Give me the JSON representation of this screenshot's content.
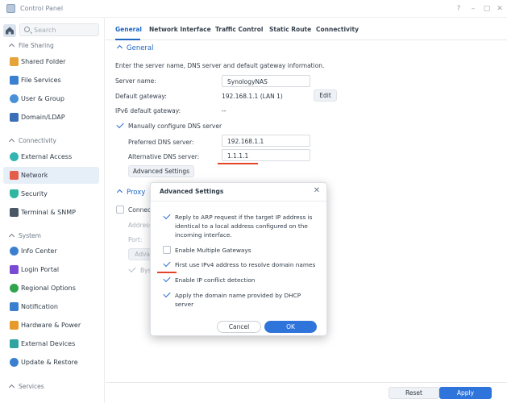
{
  "window": {
    "title": "Control Panel"
  },
  "sidebar": {
    "search_placeholder": "Search",
    "sections": [
      {
        "label": "File Sharing"
      },
      {
        "label": "Connectivity"
      },
      {
        "label": "System"
      },
      {
        "label": "Services"
      }
    ],
    "items": [
      {
        "label": "Shared Folder",
        "icon": "shared-folder-icon",
        "color": "#e6a33a"
      },
      {
        "label": "File Services",
        "icon": "file-services-icon",
        "color": "#3b7fd1"
      },
      {
        "label": "User & Group",
        "icon": "user-group-icon",
        "color": "#4a90d9"
      },
      {
        "label": "Domain/LDAP",
        "icon": "domain-ldap-icon",
        "color": "#3a6fb8"
      },
      {
        "label": "External Access",
        "icon": "external-access-icon",
        "color": "#32b4b0"
      },
      {
        "label": "Network",
        "icon": "network-icon",
        "color": "#e45d4a"
      },
      {
        "label": "Security",
        "icon": "security-icon",
        "color": "#2fb6a0"
      },
      {
        "label": "Terminal & SNMP",
        "icon": "terminal-icon",
        "color": "#4a5866"
      },
      {
        "label": "Info Center",
        "icon": "info-center-icon",
        "color": "#3b7fd1"
      },
      {
        "label": "Login Portal",
        "icon": "login-portal-icon",
        "color": "#7a4ad3"
      },
      {
        "label": "Regional Options",
        "icon": "regional-options-icon",
        "color": "#2fa44a"
      },
      {
        "label": "Notification",
        "icon": "notification-icon",
        "color": "#3b7fd1"
      },
      {
        "label": "Hardware & Power",
        "icon": "hardware-power-icon",
        "color": "#e69a2a"
      },
      {
        "label": "External Devices",
        "icon": "external-devices-icon",
        "color": "#2fa4a0"
      },
      {
        "label": "Update & Restore",
        "icon": "update-restore-icon",
        "color": "#3b7fd1"
      }
    ],
    "active_item": "Network"
  },
  "tabs": [
    {
      "label": "General",
      "active": true
    },
    {
      "label": "Network Interface"
    },
    {
      "label": "Traffic Control"
    },
    {
      "label": "Static Route"
    },
    {
      "label": "Connectivity"
    }
  ],
  "general": {
    "section_title": "General",
    "intro": "Enter the server name, DNS server and default gateway information.",
    "server_name_label": "Server name:",
    "server_name_value": "SynologyNAS",
    "default_gateway_label": "Default gateway:",
    "default_gateway_value": "192.168.1.1 (LAN 1)",
    "edit_label": "Edit",
    "ipv6_gateway_label": "IPv6 default gateway:",
    "ipv6_gateway_value": "--",
    "manual_dns_label": "Manually configure DNS server",
    "manual_dns_checked": true,
    "preferred_dns_label": "Preferred DNS server:",
    "preferred_dns_value": "192.168.1.1",
    "alternative_dns_label": "Alternative DNS server:",
    "alternative_dns_value": "1.1.1.1",
    "advanced_settings_label": "Advanced Settings"
  },
  "proxy": {
    "section_title": "Proxy",
    "connect_label": "Connect",
    "address_label": "Address",
    "port_label": "Port:",
    "advanced_label": "Advan",
    "bypass_label": "Bys"
  },
  "modal": {
    "title": "Advanced Settings",
    "options": [
      {
        "label": "Reply to ARP request if the target IP address is identical to a local address configured on the incoming interface.",
        "checked": true
      },
      {
        "label": "Enable Multiple Gateways",
        "checked": false
      },
      {
        "label": "First use IPv4 address to resolve domain names",
        "checked": true
      },
      {
        "label": "Enable IP conflict detection",
        "checked": true
      },
      {
        "label": "Apply the domain name provided by DHCP server",
        "checked": true
      }
    ],
    "cancel_label": "Cancel",
    "ok_label": "OK"
  },
  "footer": {
    "reset_label": "Reset",
    "apply_label": "Apply"
  },
  "colors": {
    "accent": "#2f74db",
    "highlight": "#e4452a",
    "active_tab": "#1f66c3"
  }
}
